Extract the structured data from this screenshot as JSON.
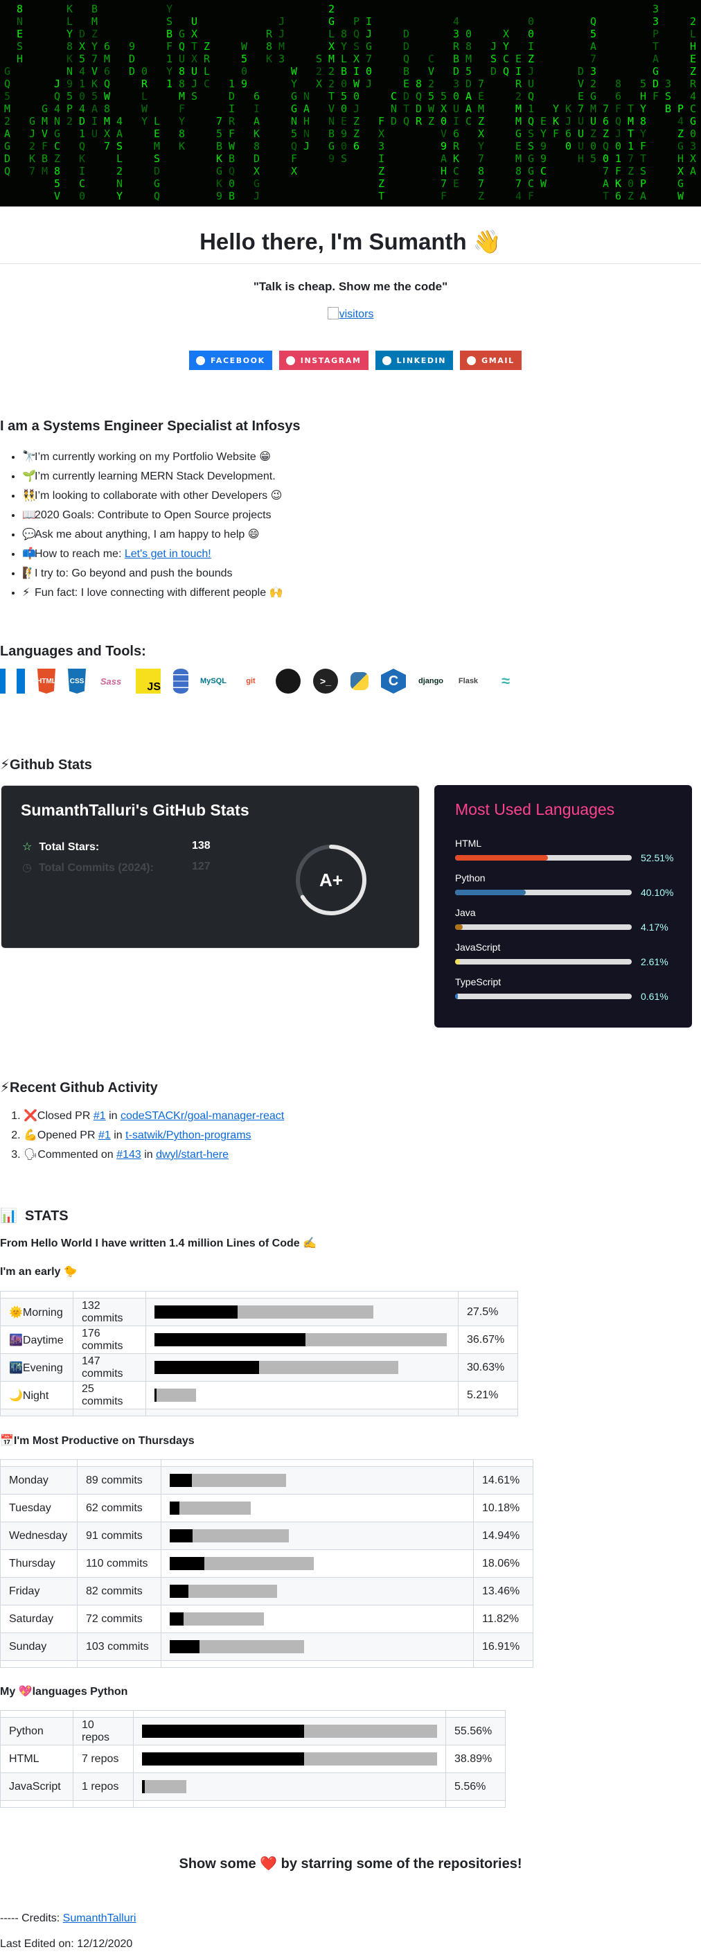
{
  "header": {
    "title": "Hello there, I'm Sumanth 👋",
    "quote": "\"Talk is cheap. Show me the code\"",
    "visitors_alt": "visitors"
  },
  "badges": [
    {
      "label": "FACEBOOK",
      "color": "#1877f2",
      "icon": "facebook-icon"
    },
    {
      "label": "INSTAGRAM",
      "color": "#e4405f",
      "icon": "instagram-icon"
    },
    {
      "label": "LINKEDIN",
      "color": "#0077b5",
      "icon": "linkedin-icon"
    },
    {
      "label": "GMAIL",
      "color": "#d14836",
      "icon": "gmail-icon"
    }
  ],
  "about": {
    "heading": "I am a Systems Engineer Specialist at Infosys",
    "items": [
      {
        "emoji": "🔭",
        "text": "I’m currently working on my Portfolio Website 😁"
      },
      {
        "emoji": "🌱",
        "text": "I’m currently learning MERN Stack Development."
      },
      {
        "emoji": "👯",
        "text": "I’m looking to collaborate with other Developers 😉"
      },
      {
        "emoji": "📖",
        "text": "2020 Goals: Contribute to Open Source projects"
      },
      {
        "emoji": "💬",
        "text": "Ask me about anything, I am happy to help 😄"
      },
      {
        "emoji": "📫",
        "text": "How to reach me: ",
        "link": "Let's get in touch!"
      },
      {
        "emoji": "🧗",
        "text": "I try to: Go beyond and push the bounds"
      },
      {
        "emoji": "⚡",
        "text": "Fun fact: I love connecting with different people 🙌"
      }
    ]
  },
  "tools": {
    "heading": "Languages and Tools:",
    "items": [
      {
        "icon": "vscode-icon",
        "color": "#0078d4",
        "text": ""
      },
      {
        "icon": "html5-icon",
        "color": "#e34f26",
        "text": "HTML"
      },
      {
        "icon": "css3-icon",
        "color": "#1572b6",
        "text": "CSS"
      },
      {
        "icon": "sass-icon",
        "color": "#cc6699",
        "text": "Sass"
      },
      {
        "icon": "javascript-icon",
        "color": "#f7df1e",
        "text": "JS"
      },
      {
        "icon": "database-icon",
        "color": "#3f6ec6",
        "text": ""
      },
      {
        "icon": "mysql-icon",
        "color": "#00758f",
        "text": "MySQL"
      },
      {
        "icon": "git-icon",
        "color": "#f05032",
        "text": "git"
      },
      {
        "icon": "github-icon",
        "color": "#181717",
        "text": ""
      },
      {
        "icon": "terminal-icon",
        "color": "#222222",
        "text": ">_"
      },
      {
        "icon": "python-icon",
        "color": "#3776ab",
        "text": ""
      },
      {
        "icon": "c-icon",
        "color": "#1e6bb8",
        "text": "C"
      },
      {
        "icon": "django-icon",
        "color": "#092e20",
        "text": "django"
      },
      {
        "icon": "flask-icon",
        "color": "#444444",
        "text": "Flask"
      },
      {
        "icon": "tailwind-icon",
        "color": "#38b2ac",
        "text": ""
      }
    ]
  },
  "github_stats": {
    "heading": "Github Stats",
    "card_title": "SumanthTalluri's GitHub Stats",
    "rows": [
      {
        "label": "Total Stars:",
        "value": "138"
      },
      {
        "label": "Total Commits (2024):",
        "value": "127"
      }
    ],
    "rank": "A+",
    "langs_title": "Most Used Languages",
    "languages": [
      {
        "name": "HTML",
        "pct": "52.51%",
        "frac": 0.5251,
        "color": "#e34c26"
      },
      {
        "name": "Python",
        "pct": "40.10%",
        "frac": 0.401,
        "color": "#3572a5"
      },
      {
        "name": "Java",
        "pct": "4.17%",
        "frac": 0.0417,
        "color": "#b07219"
      },
      {
        "name": "JavaScript",
        "pct": "2.61%",
        "frac": 0.0261,
        "color": "#f1e05a"
      },
      {
        "name": "TypeScript",
        "pct": "0.61%",
        "frac": 0.0061,
        "color": "#3178c6"
      }
    ]
  },
  "activity": {
    "heading": "Recent Github Activity",
    "items": [
      {
        "emoji": "❌",
        "action": "Closed PR ",
        "ref": "#1",
        "in": " in ",
        "repo": "codeSTACKr/goal-manager-react"
      },
      {
        "emoji": "💪",
        "action": "Opened PR ",
        "ref": "#1",
        "in": " in ",
        "repo": "t-satwik/Python-programs"
      },
      {
        "emoji": "🗣",
        "action": "Commented on ",
        "ref": "#143",
        "in": " in ",
        "repo": "dwyl/start-here"
      }
    ]
  },
  "stats": {
    "heading": "STATS",
    "lines_of_code": "From Hello World I have written 1.4 million Lines of Code ✍️",
    "early": "I'm an early 🐤",
    "time_rows": [
      {
        "emoji": "🌞",
        "name": "Morning",
        "commits": "132 commits",
        "pct": "27.5%",
        "frac": 0.275
      },
      {
        "emoji": "🌆",
        "name": "Daytime",
        "commits": "176 commits",
        "pct": "36.67%",
        "frac": 0.3667
      },
      {
        "emoji": "🌃",
        "name": "Evening",
        "commits": "147 commits",
        "pct": "30.63%",
        "frac": 0.3063
      },
      {
        "emoji": "🌙",
        "name": "Night",
        "commits": "25 commits",
        "pct": "5.21%",
        "frac": 0.0521
      }
    ],
    "productive": "I'm Most Productive on Thursdays",
    "day_rows": [
      {
        "name": "Monday",
        "commits": "89 commits",
        "pct": "14.61%",
        "frac": 0.1461
      },
      {
        "name": "Tuesday",
        "commits": "62 commits",
        "pct": "10.18%",
        "frac": 0.1018
      },
      {
        "name": "Wednesday",
        "commits": "91 commits",
        "pct": "14.94%",
        "frac": 0.1494
      },
      {
        "name": "Thursday",
        "commits": "110 commits",
        "pct": "18.06%",
        "frac": 0.1806
      },
      {
        "name": "Friday",
        "commits": "82 commits",
        "pct": "13.46%",
        "frac": 0.1346
      },
      {
        "name": "Saturday",
        "commits": "72 commits",
        "pct": "11.82%",
        "frac": 0.1182
      },
      {
        "name": "Sunday",
        "commits": "103 commits",
        "pct": "16.91%",
        "frac": 0.1691
      }
    ],
    "langs_heading_pre": "My ",
    "langs_heading_emoji": "💖",
    "langs_heading_post": "languages Python",
    "lang_rows": [
      {
        "name": "Python",
        "repos": "10 repos",
        "pct": "55.56%",
        "frac": 0.5556
      },
      {
        "name": "HTML",
        "repos": "7 repos",
        "pct": "38.89%",
        "frac": 0.3889
      },
      {
        "name": "JavaScript",
        "repos": "1 repos",
        "pct": "5.56%",
        "frac": 0.0556
      }
    ]
  },
  "footer": {
    "show_pre": "Show some ",
    "show_emoji": "❤️",
    "show_post": " by starring some of the repositories!",
    "credits_prefix": "----- Credits: ",
    "credits_link": "SumanthTalluri",
    "edited": "Last Edited on: 12/12/2020"
  }
}
